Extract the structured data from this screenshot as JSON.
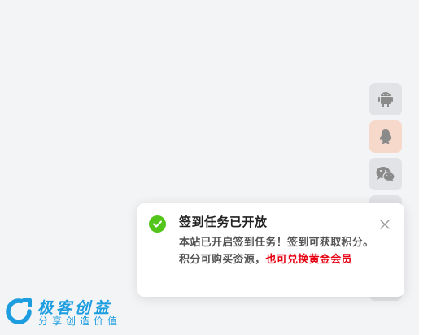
{
  "floating_sidebar": {
    "buttons": [
      {
        "icon": "android-icon"
      },
      {
        "icon": "qq-icon",
        "color": "#f6d9cb"
      },
      {
        "icon": "wechat-icon"
      }
    ]
  },
  "toast": {
    "title": "签到任务已开放",
    "message_prefix": "本站已开启签到任务！签到可获取积分。积分可购买资源，",
    "message_highlight": "也可兑换黄金会员",
    "highlight_color": "#e60012",
    "status_icon": "check-circle-icon",
    "status_color": "#52c41a",
    "close_icon": "close-icon"
  },
  "brand": {
    "name": "极客创益",
    "slogan": "分享创造价值",
    "color": "#1c9de0",
    "logo_icon": "brand-logo-icon"
  }
}
